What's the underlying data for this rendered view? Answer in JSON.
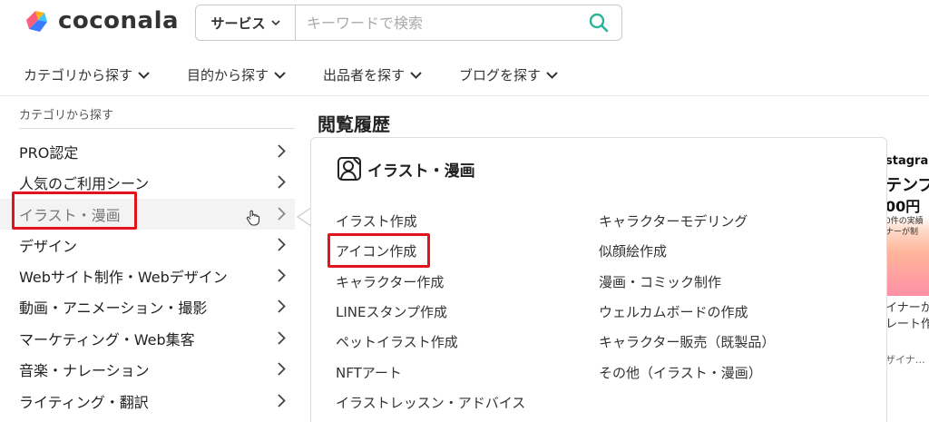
{
  "logo": {
    "text": "coconala"
  },
  "search": {
    "category": "サービス",
    "placeholder": "キーワードで検索"
  },
  "nav": [
    {
      "label": "カテゴリから探す"
    },
    {
      "label": "目的から探す"
    },
    {
      "label": "出品者を探す"
    },
    {
      "label": "ブログを探す"
    }
  ],
  "sidebar": {
    "heading": "カテゴリから探す",
    "items": [
      {
        "label": "PRO認定"
      },
      {
        "label": "人気のご利用シーン"
      },
      {
        "label": "イラスト・漫画"
      },
      {
        "label": "デザイン"
      },
      {
        "label": "Webサイト制作・Webデザイン"
      },
      {
        "label": "動画・アニメーション・撮影"
      },
      {
        "label": "マーケティング・Web集客"
      },
      {
        "label": "音楽・ナレーション"
      },
      {
        "label": "ライティング・翻訳"
      }
    ]
  },
  "main": {
    "history_title": "閲覧履歴",
    "panel_title": "イラスト・漫画",
    "left_links": [
      {
        "label": "イラスト作成"
      },
      {
        "label": "アイコン作成"
      },
      {
        "label": "キャラクター作成"
      },
      {
        "label": "LINEスタンプ作成"
      },
      {
        "label": "ペットイラスト作成"
      },
      {
        "label": "NFTアート"
      },
      {
        "label": "イラストレッスン・アドバイス"
      }
    ],
    "right_links": [
      {
        "label": "キャラクターモデリング"
      },
      {
        "label": "似顔絵作成"
      },
      {
        "label": "漫画・コミック制作"
      },
      {
        "label": "ウェルカムボードの作成"
      },
      {
        "label": "キャラクター販売（既製品）"
      },
      {
        "label": "その他（イラスト・漫画）"
      }
    ]
  },
  "ad": {
    "line1": "stagram",
    "line2": "テンプ",
    "line3": "00円",
    "line4": "0件の実績",
    "line5": "ナーが制",
    "line6": "イナーか",
    "line7": "レート作",
    "line8": "ザイナ…"
  },
  "colors": {
    "highlight": "#e1141b",
    "search_icon": "#2ab39a"
  }
}
